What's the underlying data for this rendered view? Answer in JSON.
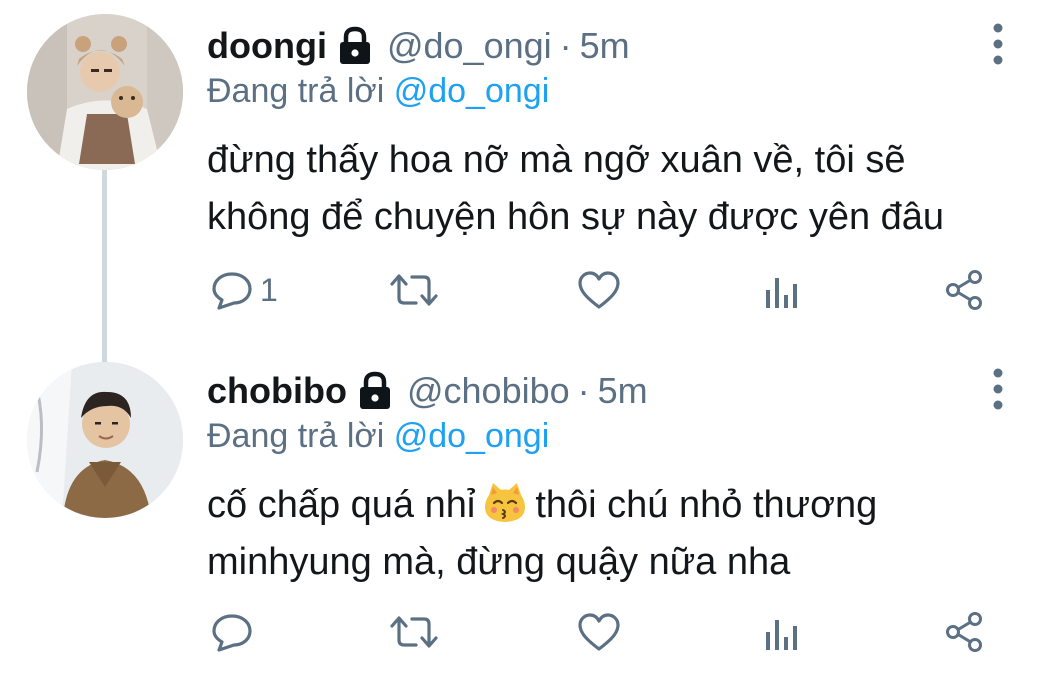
{
  "colors": {
    "text": "#14171a",
    "secondary": "#5b7083",
    "mention": "#1da1f2",
    "thread_line": "#cfd9de"
  },
  "tweets": [
    {
      "display_name": "doongi",
      "handle": "@do_ongi",
      "separator": "·",
      "time": "5m",
      "reply_prefix": "Đang trả lời",
      "reply_mention": "@do_ongi",
      "text_lines": [
        "đừng thấy hoa nỡ mà ngỡ xuân về, tôi sẽ",
        "không để chuyện hôn sự này được yên đâu"
      ],
      "reply_count": "1",
      "icons": {
        "lock": "lock-icon",
        "more": "more-vertical-icon",
        "reply": "reply-icon",
        "retweet": "retweet-icon",
        "like": "heart-icon",
        "stats": "analytics-icon",
        "share": "share-icon"
      }
    },
    {
      "display_name": "chobibo",
      "handle": "@chobibo",
      "separator": "·",
      "time": "5m",
      "reply_prefix": "Đang trả lời",
      "reply_mention": "@do_ongi",
      "text_line1_before": "cố chấp quá nhỉ",
      "emoji": "kissing-cat-emoji",
      "text_line1_after": "thôi chú nhỏ thương",
      "text_line2": "minhyung mà, đừng quậy nữa nha",
      "reply_count": "",
      "icons": {
        "lock": "lock-icon",
        "more": "more-vertical-icon",
        "reply": "reply-icon",
        "retweet": "retweet-icon",
        "like": "heart-icon",
        "stats": "analytics-icon",
        "share": "share-icon"
      }
    }
  ]
}
